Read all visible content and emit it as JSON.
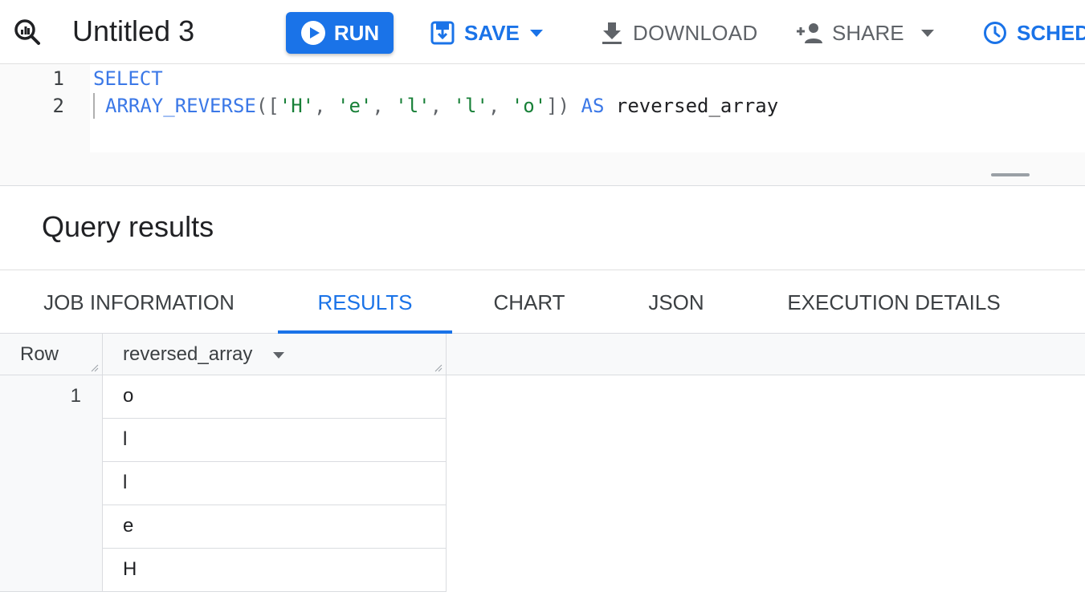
{
  "toolbar": {
    "query_icon": "query-magnifier-icon",
    "title": "Untitled 3",
    "run_label": "RUN",
    "save_label": "SAVE",
    "download_label": "DOWNLOAD",
    "share_label": "SHARE",
    "schedule_label": "SCHED",
    "accent_color": "#1a73e8"
  },
  "editor": {
    "lines": [
      {
        "number": "1",
        "tokens": [
          {
            "text": "SELECT",
            "type": "kw"
          }
        ]
      },
      {
        "number": "2",
        "tokens": [
          {
            "text": "ARRAY_REVERSE",
            "type": "fn"
          },
          {
            "text": "([",
            "type": "pun"
          },
          {
            "text": "'H'",
            "type": "str"
          },
          {
            "text": ", ",
            "type": "pun"
          },
          {
            "text": "'e'",
            "type": "str"
          },
          {
            "text": ", ",
            "type": "pun"
          },
          {
            "text": "'l'",
            "type": "str"
          },
          {
            "text": ", ",
            "type": "pun"
          },
          {
            "text": "'l'",
            "type": "str"
          },
          {
            "text": ", ",
            "type": "pun"
          },
          {
            "text": "'o'",
            "type": "str"
          },
          {
            "text": "])",
            "type": "pun"
          },
          {
            "text": " AS ",
            "type": "kw"
          },
          {
            "text": "reversed_array",
            "type": "plain"
          }
        ]
      }
    ]
  },
  "results": {
    "title": "Query results",
    "tabs": [
      {
        "label": "JOB INFORMATION",
        "active": false
      },
      {
        "label": "RESULTS",
        "active": true
      },
      {
        "label": "CHART",
        "active": false
      },
      {
        "label": "JSON",
        "active": false
      },
      {
        "label": "EXECUTION DETAILS",
        "active": false
      }
    ],
    "columns": {
      "row_header": "Row",
      "value_header": "reversed_array"
    },
    "rows": [
      {
        "row": "1",
        "values": [
          "o",
          "l",
          "l",
          "e",
          "H"
        ]
      }
    ]
  }
}
